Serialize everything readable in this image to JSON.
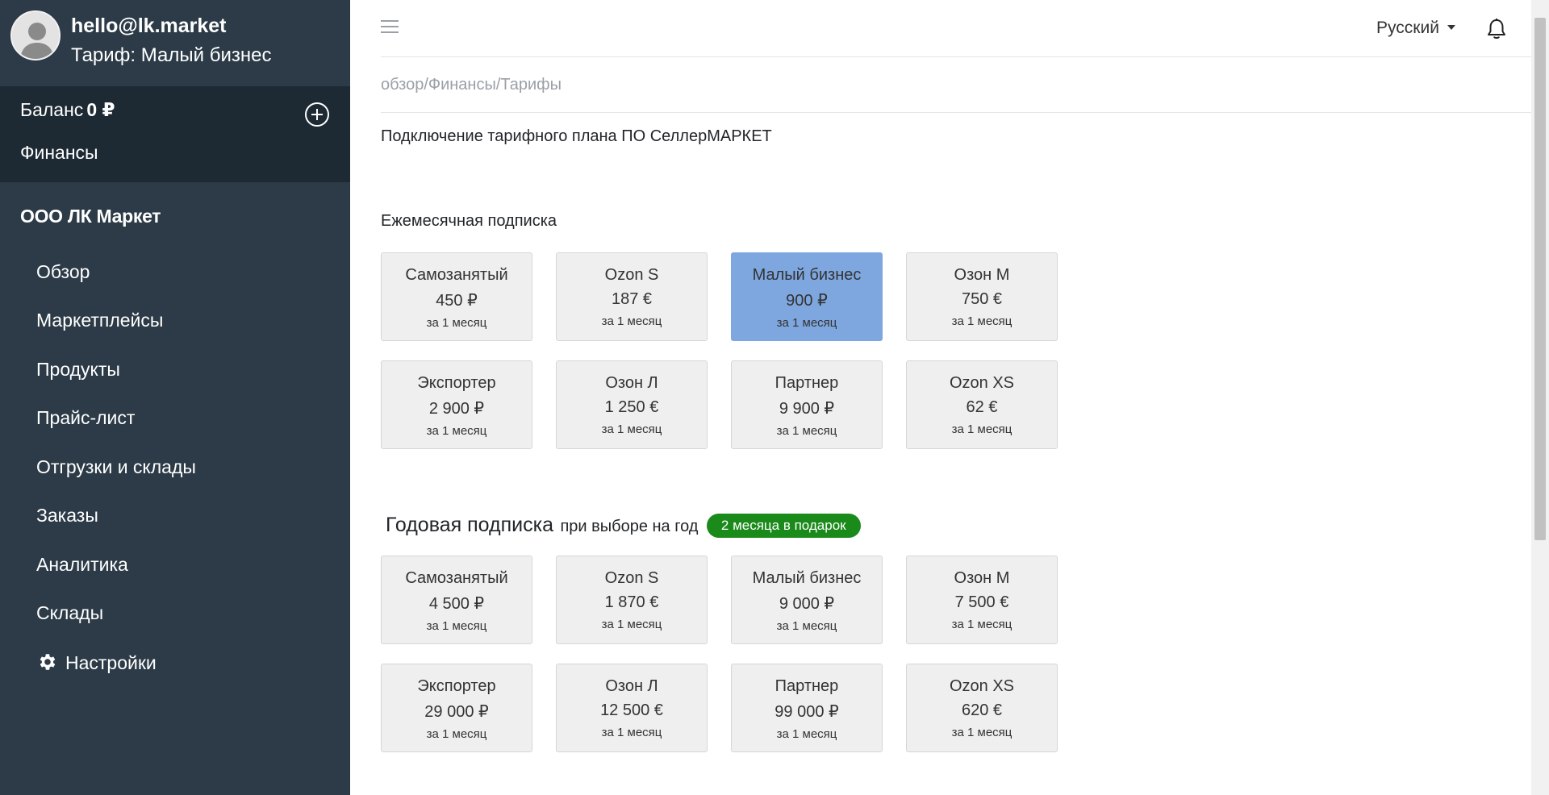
{
  "user": {
    "email": "hello@lk.market",
    "tariff": "Тариф: Малый бизнес"
  },
  "finance": {
    "balance_label": "Баланс",
    "balance_value": "0 ₽",
    "finance_link": "Финансы"
  },
  "company": "ООО ЛК Маркет",
  "nav": [
    {
      "label": "Обзор"
    },
    {
      "label": "Маркетплейсы"
    },
    {
      "label": "Продукты"
    },
    {
      "label": "Прайс-лист"
    },
    {
      "label": "Отгрузки и склады"
    },
    {
      "label": "Заказы"
    },
    {
      "label": "Аналитика"
    },
    {
      "label": "Склады"
    },
    {
      "label": "Настройки",
      "icon": "gear-icon"
    }
  ],
  "topbar": {
    "language": "Русский"
  },
  "breadcrumb": "обзор/Финансы/Тарифы",
  "page_title": "Подключение тарифного плана ПО СеллерМАРКЕТ",
  "monthly": {
    "title": "Ежемесячная подписка",
    "plans": [
      {
        "name": "Самозанятый",
        "price": "450 ₽",
        "period": "за 1 месяц"
      },
      {
        "name": "Ozon S",
        "price": "187 €",
        "period": "за 1 месяц"
      },
      {
        "name": "Малый бизнес",
        "price": "900 ₽",
        "period": "за 1 месяц",
        "selected": true
      },
      {
        "name": "Озон М",
        "price": "750 €",
        "period": "за 1 месяц"
      },
      {
        "name": "Экспортер",
        "price": "2 900 ₽",
        "period": "за 1 месяц"
      },
      {
        "name": "Озон Л",
        "price": "1 250 €",
        "period": "за 1 месяц"
      },
      {
        "name": "Партнер",
        "price": "9 900 ₽",
        "period": "за 1 месяц"
      },
      {
        "name": "Ozon XS",
        "price": "62 €",
        "period": "за 1 месяц"
      }
    ]
  },
  "yearly": {
    "title": "Годовая подписка",
    "subtitle": "при выборе на год",
    "badge": "2 месяца в подарок",
    "plans": [
      {
        "name": "Самозанятый",
        "price": "4 500 ₽",
        "period": "за 1 месяц"
      },
      {
        "name": "Ozon S",
        "price": "1 870 €",
        "period": "за 1 месяц"
      },
      {
        "name": "Малый бизнес",
        "price": "9 000 ₽",
        "period": "за 1 месяц"
      },
      {
        "name": "Озон М",
        "price": "7 500 €",
        "period": "за 1 месяц"
      },
      {
        "name": "Экспортер",
        "price": "29 000 ₽",
        "period": "за 1 месяц"
      },
      {
        "name": "Озон Л",
        "price": "12 500 €",
        "period": "за 1 месяц"
      },
      {
        "name": "Партнер",
        "price": "99 000 ₽",
        "period": "за 1 месяц"
      },
      {
        "name": "Ozon XS",
        "price": "620 €",
        "period": "за 1 месяц"
      }
    ]
  },
  "colors": {
    "sidebar": "#2c3b47",
    "sidebar_dark": "#1e2a33",
    "selected_card": "#7ea7df",
    "badge": "#1a8a1a"
  }
}
